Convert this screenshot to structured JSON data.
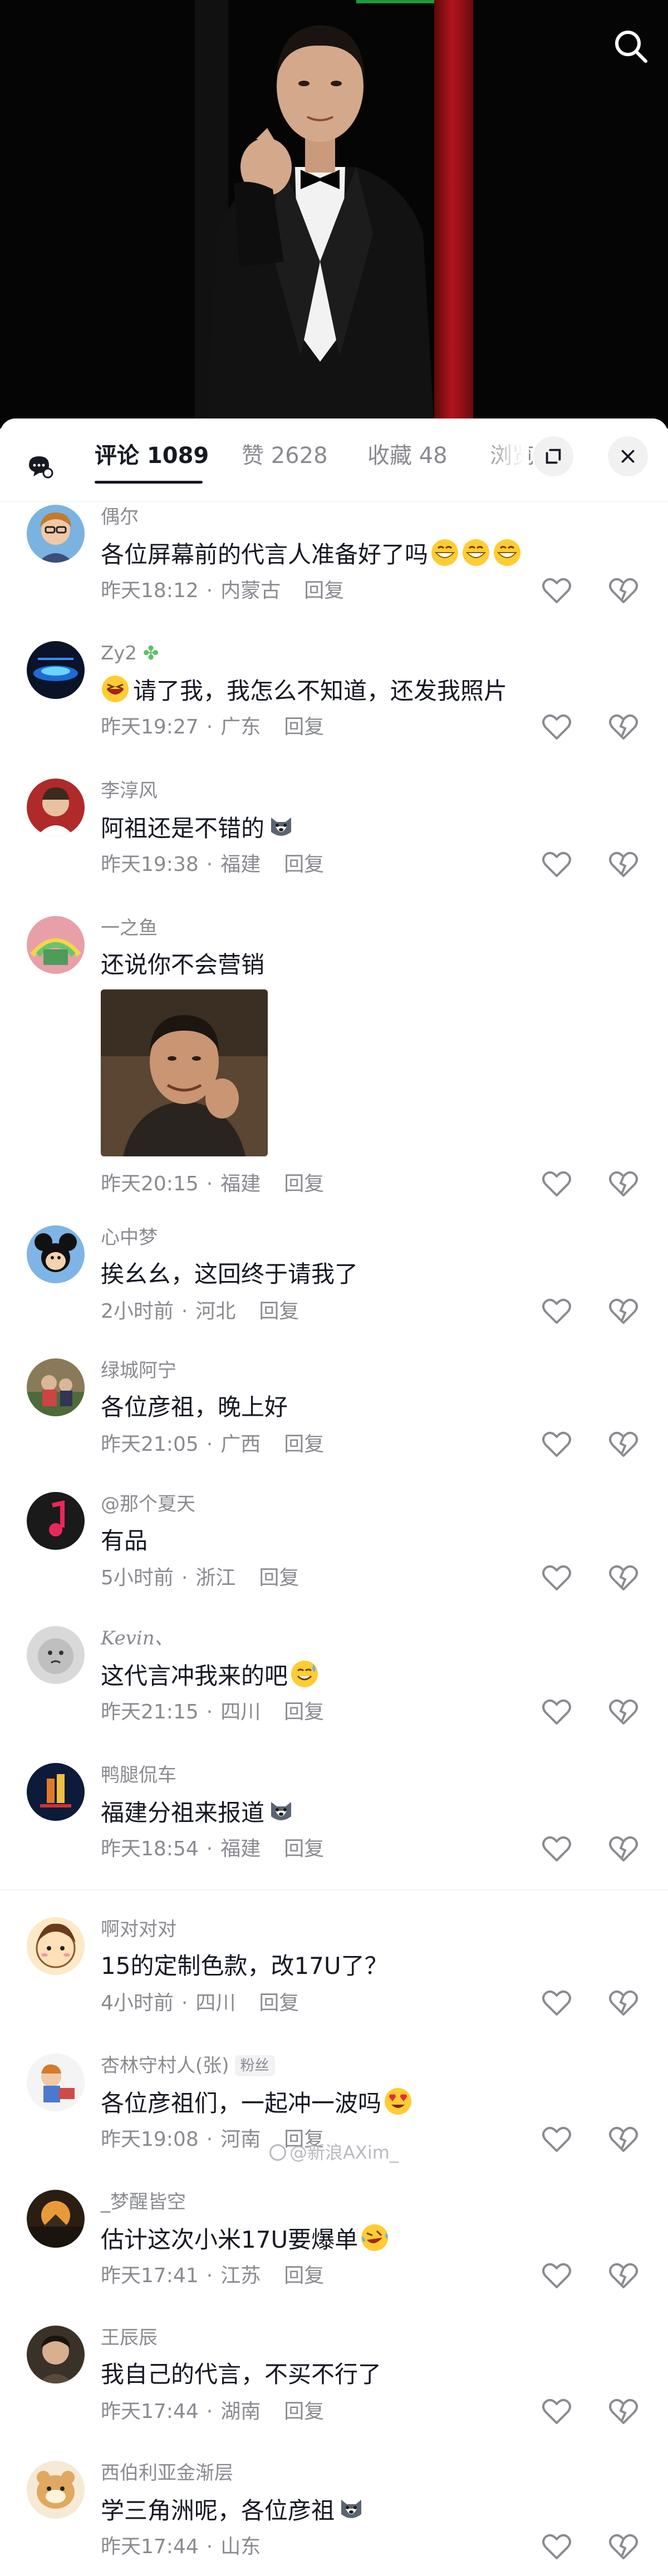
{
  "tabs": [
    {
      "label": "评论",
      "count": "1089"
    },
    {
      "label": "赞",
      "count": "2628"
    },
    {
      "label": "收藏",
      "count": "48"
    },
    {
      "label": "浏览",
      "count": ""
    }
  ],
  "comments": [
    {
      "user": "偶尔",
      "text": "各位屏幕前的代言人准备好了吗",
      "emojis": [
        "grin-emoji",
        "grin-emoji",
        "grin-emoji"
      ],
      "time": "昨天18:12",
      "location": "内蒙古",
      "reply": "回复"
    },
    {
      "user": "Zy2",
      "user_badge_icon": "clover-icon",
      "text": "请了我，我怎么不知道，还发我照片",
      "lead_emoji": "laugh-emoji",
      "time": "昨天19:27",
      "location": "广东",
      "reply": "回复"
    },
    {
      "user": "李淳风",
      "text": "阿祖还是不错的",
      "emojis": [
        "husky-emoji"
      ],
      "time": "昨天19:38",
      "location": "福建",
      "reply": "回复"
    },
    {
      "user": "一之鱼",
      "text": "还说你不会营销",
      "has_image": true,
      "time": "昨天20:15",
      "location": "福建",
      "reply": "回复"
    },
    {
      "user": "心中梦",
      "text": "挨幺幺，这回终于请我了",
      "time": "2小时前",
      "location": "河北",
      "reply": "回复"
    },
    {
      "user": "绿城阿宁",
      "text": "各位彦祖，晚上好",
      "time": "昨天21:05",
      "location": "广西",
      "reply": "回复"
    },
    {
      "user": "@那个夏天",
      "text": "有品",
      "time": "5小时前",
      "location": "浙江",
      "reply": "回复"
    },
    {
      "user": "Kevin、",
      "text": "这代言冲我来的吧",
      "emojis": [
        "sweat-smile-emoji"
      ],
      "time": "昨天21:15",
      "location": "四川",
      "reply": "回复"
    },
    {
      "user": "鸭腿侃车",
      "text": "福建分祖来报道",
      "emojis": [
        "husky-emoji"
      ],
      "time": "昨天18:54",
      "location": "福建",
      "reply": "回复"
    },
    {
      "user": "啊对对对",
      "text": "15的定制色款，改17U了？",
      "time": "4小时前",
      "location": "四川",
      "reply": "回复"
    },
    {
      "user": "杏林守村人(张)",
      "badge": "粉丝",
      "text": "各位彦祖们，一起冲一波吗",
      "emojis": [
        "heart-eyes-emoji"
      ],
      "time": "昨天19:08",
      "location": "河南",
      "reply": "回复"
    },
    {
      "user": "_梦醒皆空",
      "text": "估计这次小米17U要爆单",
      "emojis": [
        "rofl-emoji"
      ],
      "time": "昨天17:41",
      "location": "江苏",
      "reply": "回复"
    },
    {
      "user": "王辰辰",
      "text": "我自己的代言，不买不行了",
      "time": "昨天17:44",
      "location": "湖南",
      "reply": "回复"
    },
    {
      "user": "西伯利亚金渐层",
      "text": "学三角洲呢，各位彦祖",
      "emojis": [
        "husky-emoji"
      ],
      "time": "昨天17:44",
      "location": "山东",
      "reply": "回复"
    }
  ],
  "watermark": "@新浪AXim_",
  "colors": {
    "accent": "#161823",
    "muted": "#8a8b91",
    "curtain": "#b3141c"
  }
}
